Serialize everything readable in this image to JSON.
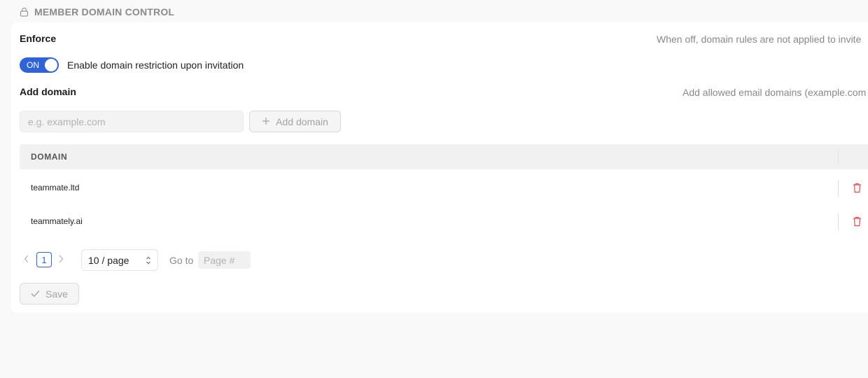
{
  "section": {
    "title": "MEMBER DOMAIN CONTROL",
    "icon": "lock-icon"
  },
  "enforce": {
    "label": "Enforce",
    "hint": "When off, domain rules are not applied to invite",
    "toggle_state": "ON",
    "toggle_on": true,
    "toggle_label": "Enable domain restriction upon invitation"
  },
  "add_domain": {
    "label": "Add domain",
    "hint": "Add allowed email domains (example.com",
    "input_placeholder": "e.g. example.com",
    "input_value": "",
    "button_label": "Add domain",
    "button_icon": "plus-icon"
  },
  "table": {
    "column_domain": "DOMAIN",
    "rows": [
      {
        "domain": "teammate.ltd",
        "action_icon": "trash-icon"
      },
      {
        "domain": "teammately.ai",
        "action_icon": "trash-icon"
      }
    ]
  },
  "pagination": {
    "current_page": "1",
    "page_size": "10 / page",
    "goto_label": "Go to",
    "goto_placeholder": "Page #"
  },
  "save": {
    "label": "Save",
    "icon": "check-icon"
  },
  "colors": {
    "accent": "#2f63d6",
    "danger": "#e5484d",
    "muted": "#8a8a8a"
  }
}
